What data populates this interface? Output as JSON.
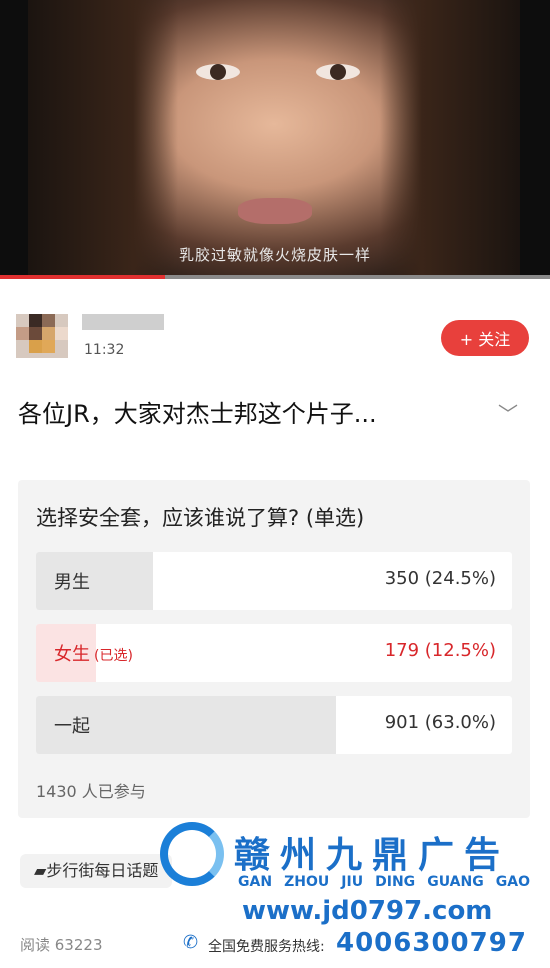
{
  "video": {
    "subtitle": "乳胶过敏就像火烧皮肤一样",
    "progress": 0.3
  },
  "post": {
    "time": "11:32",
    "follow_label": "+ 关注",
    "title": "各位JR，大家对杰士邦这个片子...",
    "chevron": "﹀"
  },
  "poll": {
    "question": "选择安全套，应该谁说了算? (单选)",
    "options": [
      {
        "label": "男生",
        "count": "350 (24.5%)",
        "share": 0.245,
        "selected": false
      },
      {
        "label": "女生",
        "note": "(已选)",
        "count": "179 (12.5%)",
        "share": 0.125,
        "selected": true
      },
      {
        "label": "一起",
        "count": "901 (63.0%)",
        "share": 0.63,
        "selected": false
      }
    ],
    "voters": "1430 人已参与"
  },
  "footer": {
    "tag_icon": "▰",
    "tag": "步行街每日话题",
    "reads": "阅读 63223"
  },
  "watermark": {
    "name": "赣州九鼎广告",
    "pinyin": [
      "GAN",
      "ZHOU",
      "JIU",
      "DING",
      "GUANG",
      "GAO"
    ],
    "url": "www.jd0797.com",
    "hotline_label": "全国免费服务热线:",
    "phone": "4006300797"
  },
  "colors": {
    "accent": "#e8403c",
    "selected": "#d8272b",
    "watermark": "#1b6fc8"
  }
}
